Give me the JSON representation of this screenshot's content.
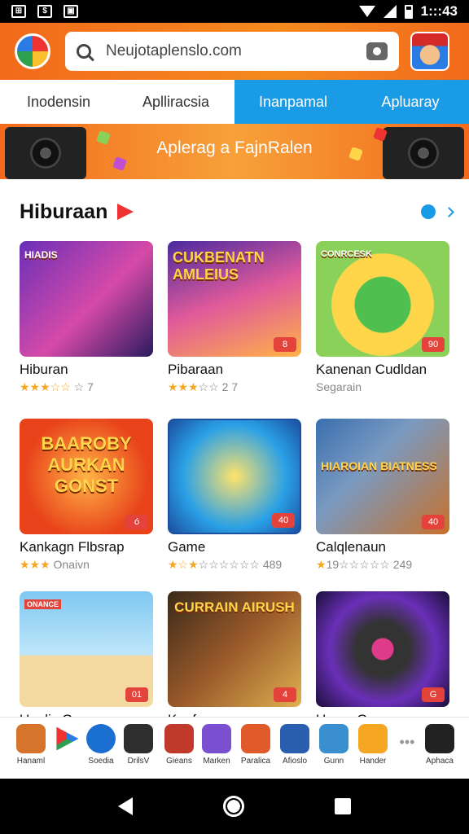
{
  "status": {
    "time": "1:::43"
  },
  "search": {
    "value": "Neujotaplenslo.com"
  },
  "tabs": [
    {
      "label": "Inodensin"
    },
    {
      "label": "Aplliracsia"
    },
    {
      "label": "Inanpamal"
    },
    {
      "label": "Apluaray"
    }
  ],
  "banner": {
    "text": "Aplerag a FajnRalen"
  },
  "section": {
    "title": "Hiburaan"
  },
  "cards": [
    {
      "name": "Hiburan",
      "meta": "☆ 7",
      "stars": "★★★☆☆",
      "badge": "",
      "label": "HIADIS"
    },
    {
      "name": "Pibaraan",
      "meta": "☆☆ 2 7",
      "stars": "★★★",
      "badge": "8",
      "label": "CUKBENATN AMLEIUS"
    },
    {
      "name": "Kanenan Cudldan",
      "meta": "Segarain",
      "stars": "",
      "badge": "90",
      "label": "CONRCESK"
    },
    {
      "name": "Kankagn Flbsrap",
      "meta": "Onaivn",
      "stars": "★★★",
      "badge": "ó",
      "label": "BAAROBY AURKAN GONST"
    },
    {
      "name": "Game",
      "meta": "☆☆☆☆☆☆ 489",
      "stars": "★☆★",
      "badge": "40",
      "label": ""
    },
    {
      "name": "Calqlenaun",
      "meta": "19☆☆☆☆☆ 249",
      "stars": "★",
      "badge": "40",
      "label": "HIAROIAN BIATNESS"
    },
    {
      "name": "Uaplis Game",
      "meta": "",
      "stars": "",
      "badge": "01",
      "label": "ONANCE"
    },
    {
      "name": "Kanfaranan",
      "meta": "",
      "stars": "",
      "badge": "4",
      "label": "CURRAIN AIRUSH"
    },
    {
      "name": "Una a Game",
      "meta": "",
      "stars": "",
      "badge": "G",
      "label": ""
    }
  ],
  "dock": [
    {
      "label": "Hanaml"
    },
    {
      "label": ""
    },
    {
      "label": "Soedia"
    },
    {
      "label": "DrilsV"
    },
    {
      "label": "Gieans"
    },
    {
      "label": "Marken"
    },
    {
      "label": "Paralica"
    },
    {
      "label": "Afioslo"
    },
    {
      "label": "Gunn"
    },
    {
      "label": "Hander"
    },
    {
      "label": ""
    },
    {
      "label": "Aphaca"
    }
  ],
  "colors": {
    "accent": "#f26a1b",
    "tab_active": "#1a9be6",
    "badge": "#e3433a",
    "star": "#f5a623"
  }
}
